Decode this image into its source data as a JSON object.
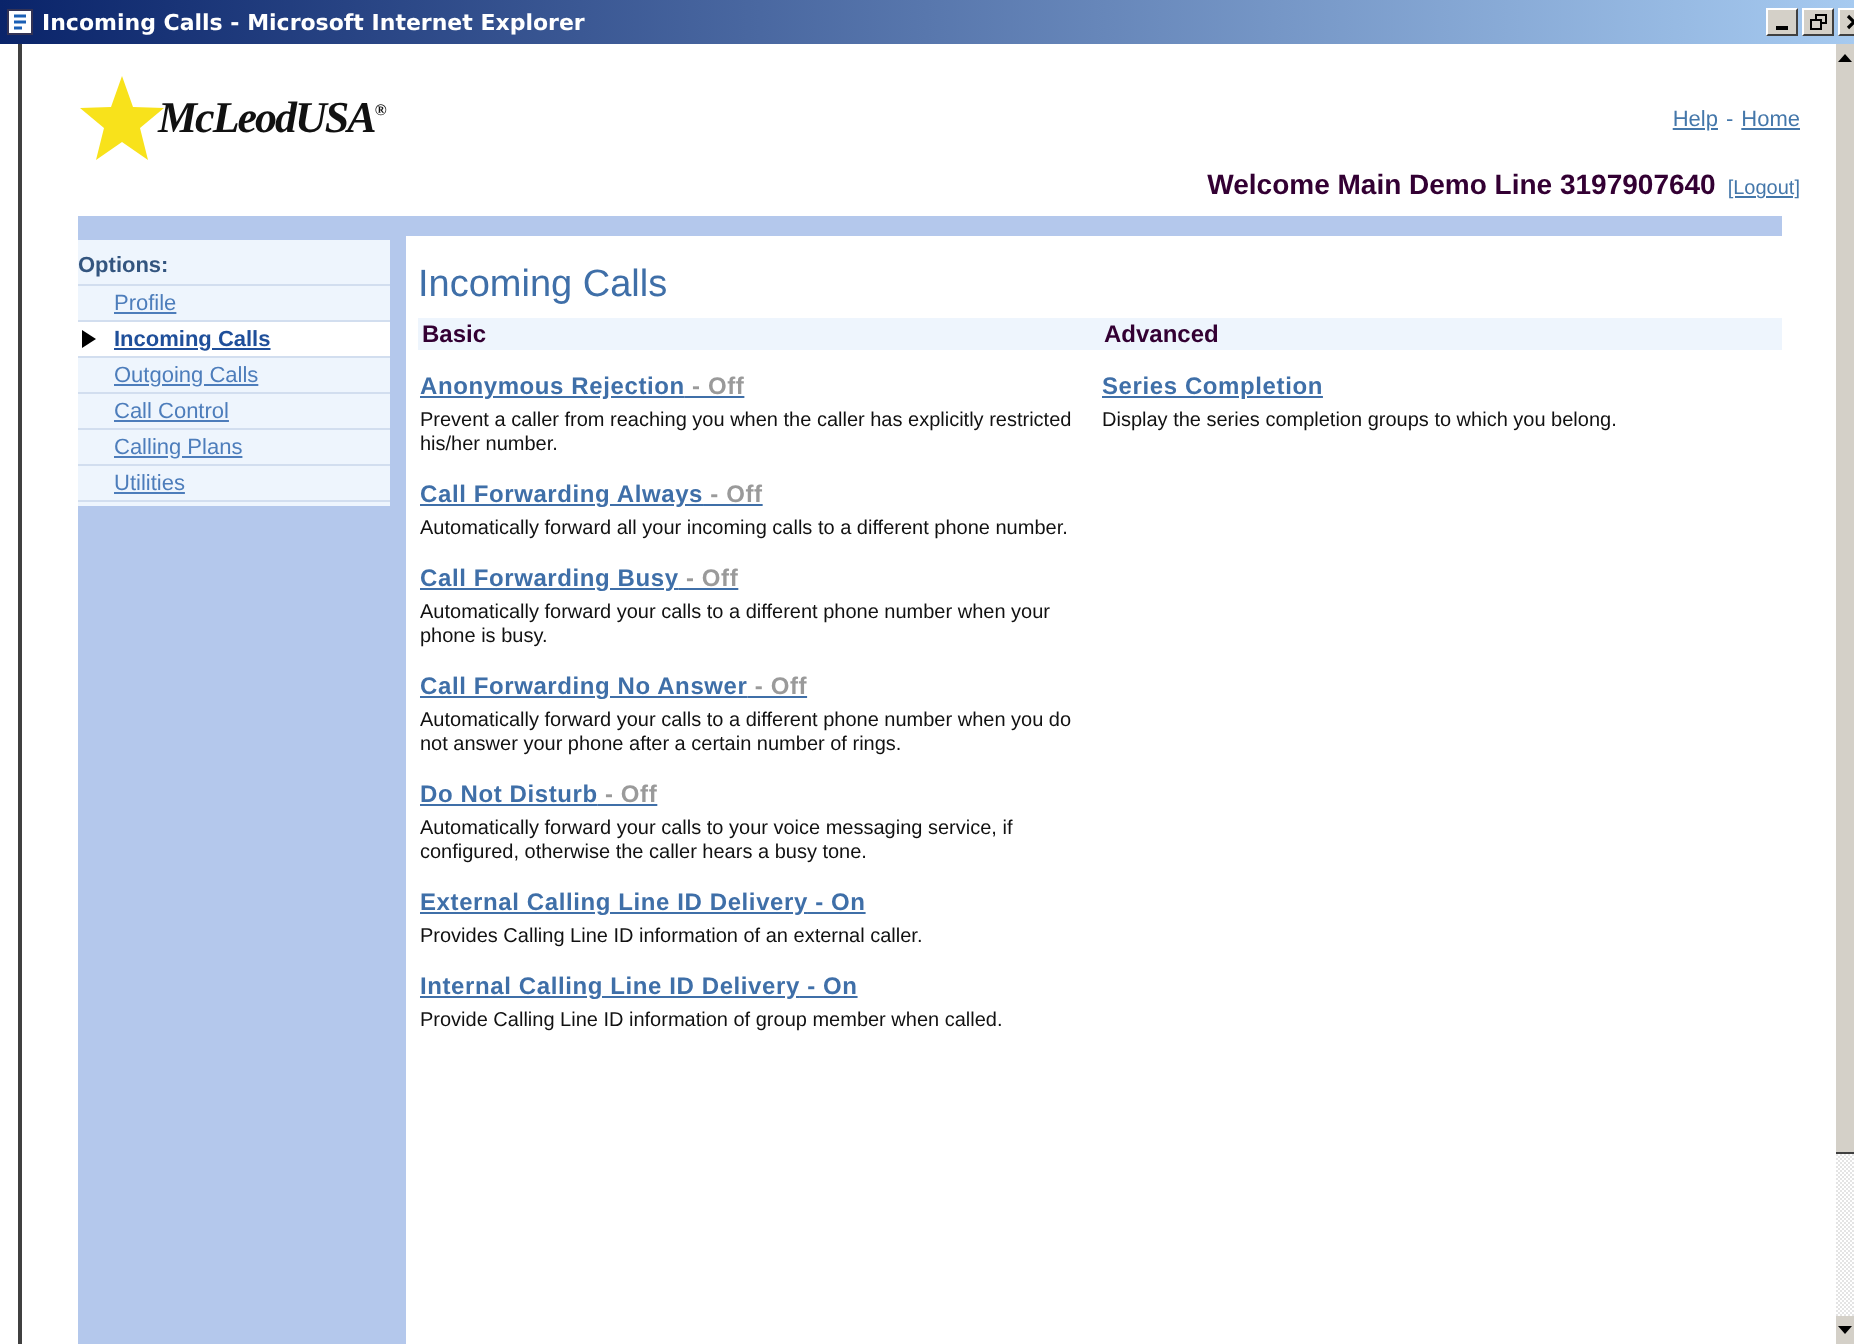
{
  "window": {
    "title": "Incoming Calls - Microsoft Internet Explorer"
  },
  "header": {
    "logo": "McLeodUSA",
    "logo_mark": "®",
    "links": [
      "Help",
      "Home"
    ],
    "link_separator": "-",
    "welcome": "Welcome Main Demo Line 3197907640",
    "logout": "[Logout]"
  },
  "sidebar": {
    "heading": "Options:",
    "items": [
      {
        "label": "Profile",
        "selected": false
      },
      {
        "label": "Incoming Calls",
        "selected": true
      },
      {
        "label": "Outgoing Calls",
        "selected": false
      },
      {
        "label": "Call Control",
        "selected": false
      },
      {
        "label": "Calling Plans",
        "selected": false
      },
      {
        "label": "Utilities",
        "selected": false
      }
    ]
  },
  "page_title": "Incoming Calls",
  "sections": [
    {
      "heading": "Basic",
      "features": [
        {
          "name": "Anonymous Rejection",
          "status": "- Off",
          "on": false,
          "description": "Prevent a caller from reaching you when the caller has explicitly restricted his/her number."
        },
        {
          "name": "Call Forwarding Always",
          "status": "- Off",
          "on": false,
          "description": "Automatically forward all your incoming calls to a different phone number."
        },
        {
          "name": "Call Forwarding Busy",
          "status": "- Off",
          "on": false,
          "description": "Automatically forward your calls to a different phone number when your phone is busy."
        },
        {
          "name": "Call Forwarding No Answer",
          "status": "- Off",
          "on": false,
          "description": "Automatically forward your calls to a different phone number when you do not answer your phone after a certain number of rings."
        },
        {
          "name": "Do Not Disturb",
          "status": "- Off",
          "on": false,
          "description": "Automatically forward your calls to your voice messaging service, if configured, otherwise the caller hears a busy tone."
        },
        {
          "name": "External Calling Line ID Delivery",
          "status": "- On",
          "on": true,
          "description": "Provides Calling Line ID information of an external caller."
        },
        {
          "name": "Internal Calling Line ID Delivery",
          "status": "- On",
          "on": true,
          "description": "Provide Calling Line ID information of group member when called."
        }
      ]
    },
    {
      "heading": "Advanced",
      "features": [
        {
          "name": "Series Completion",
          "description": "Display the series completion groups to which you belong."
        }
      ]
    }
  ]
}
